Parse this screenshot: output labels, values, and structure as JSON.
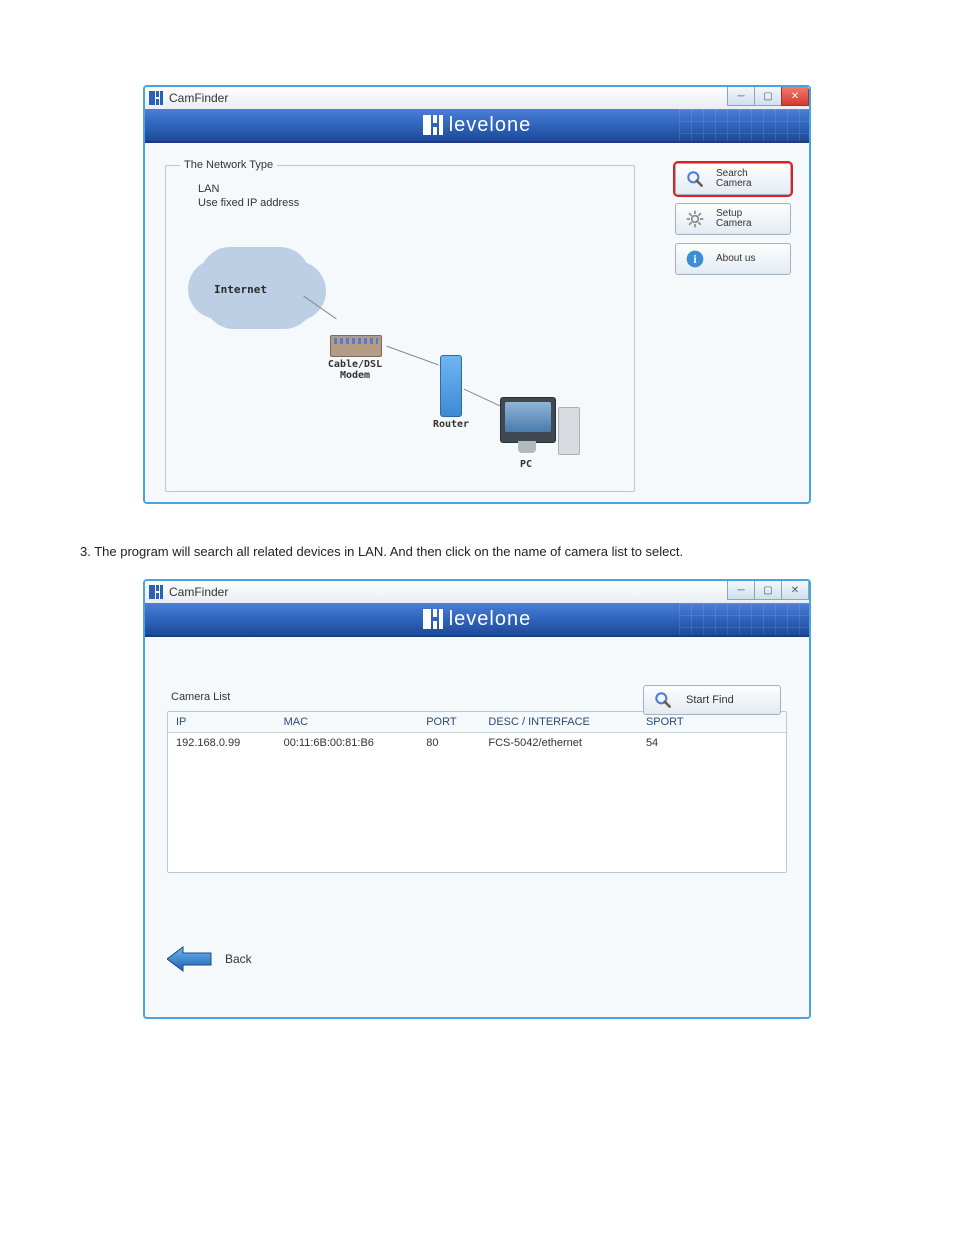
{
  "doc": {
    "intro1": "",
    "intro2": "3. The program will search all related devices in LAN. And then click on the name of camera list to select."
  },
  "window1": {
    "title": "CamFinder",
    "brand": "levelone",
    "network_type_legend": "The Network Type",
    "network_type_line1": "LAN",
    "network_type_line2": "Use fixed IP address",
    "diagram": {
      "internet": "Internet",
      "modem": "Cable/DSL\nModem",
      "router": "Router",
      "pc": "PC"
    },
    "buttons": {
      "search": "Search\nCamera",
      "setup": "Setup\nCamera",
      "about": "About us"
    }
  },
  "window2": {
    "title": "CamFinder",
    "brand": "levelone",
    "camera_list_label": "Camera List",
    "start_find": "Start Find",
    "columns": {
      "ip": "IP",
      "mac": "MAC",
      "port": "PORT",
      "desc": "DESC / INTERFACE",
      "sport": "SPORT"
    },
    "rows": [
      {
        "ip": "192.168.0.99",
        "mac": "00:11:6B:00:81:B6",
        "port": "80",
        "desc": "FCS-5042/ethernet",
        "sport": "54"
      }
    ],
    "back": "Back"
  }
}
